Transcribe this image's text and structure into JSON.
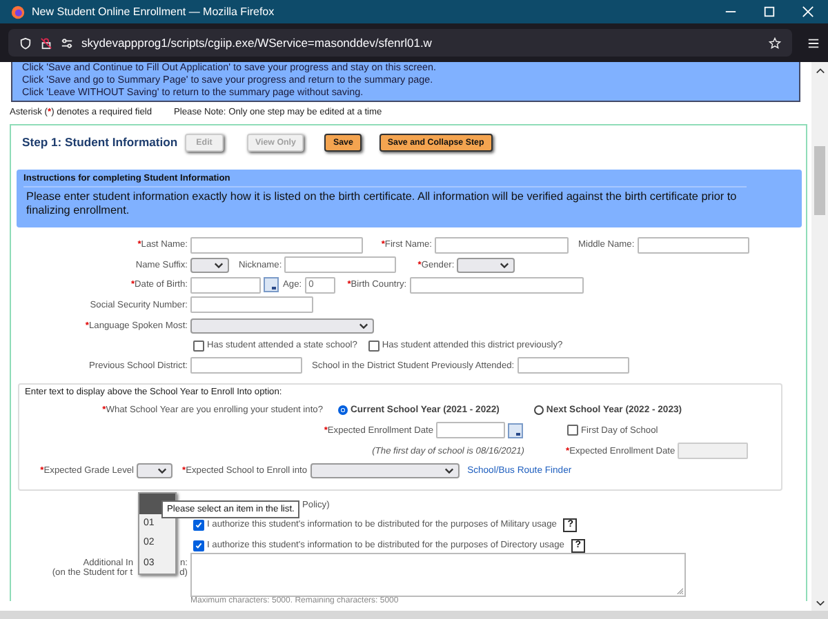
{
  "window": {
    "title": "New Student Online Enrollment — Mozilla Firefox",
    "url": "skydevappprog1/scripts/cgiip.exe/WService=masonddev/sfenrl01.w"
  },
  "notice_lines": [
    "Click 'Save and Continue to Fill Out Application' to save your progress and stay on this screen.",
    "Click 'Save and go to Summary Page' to save your progress and return to the summary page.",
    "Click 'Leave WITHOUT Saving' to return to the summary page without saving."
  ],
  "required_mark": "*",
  "legend": {
    "before": "Asterisk (",
    "after": ") denotes a required field",
    "note": "Please Note: Only one step may be edited at a time"
  },
  "step": {
    "title": "Step 1: Student Information",
    "buttons": [
      {
        "label": "Edit",
        "disabled": true
      },
      {
        "label": "View Only",
        "disabled": true
      },
      {
        "label": "Save",
        "disabled": false
      },
      {
        "label": "Save and Collapse Step",
        "disabled": false
      }
    ]
  },
  "instructions": {
    "heading": "Instructions for completing Student Information",
    "text": "Please enter student information exactly how it is listed on the birth certificate. All information will be verified against the birth certificate prior to finalizing enrollment."
  },
  "student": {
    "last_name": {
      "label": "Last Name:",
      "required": true
    },
    "first_name": {
      "label": "First Name:",
      "required": true
    },
    "middle_name": {
      "label": "Middle Name:",
      "required": false
    },
    "name_suffix": {
      "label": "Name Suffix:",
      "required": false
    },
    "nickname": {
      "label": "Nickname:",
      "required": false
    },
    "gender": {
      "label": "Gender:",
      "required": true
    },
    "date_of_birth": {
      "label": "Date of Birth:",
      "required": true
    },
    "age": {
      "label": "Age:",
      "value": "0"
    },
    "birth_country": {
      "label": "Birth Country:",
      "required": true
    },
    "ssn": {
      "label": "Social Security Number:",
      "required": false
    },
    "language": {
      "label": "Language Spoken Most:",
      "required": true
    },
    "attended_state": {
      "label": "Has student attended a state school?",
      "checked": false
    },
    "attended_district": {
      "label": "Has student attended this district previously?",
      "checked": false
    },
    "previous_district": {
      "label": "Previous School District:"
    },
    "previous_school": {
      "label": "School in the District Student Previously Attended:"
    }
  },
  "enroll": {
    "heading": "Enter text to display above the School Year to Enroll Into option:",
    "question": {
      "label": "What School Year are you enrolling your student into?",
      "required": true
    },
    "options": [
      {
        "label": "Current School Year (2021 - 2022)",
        "selected": true
      },
      {
        "label": "Next School Year (2022 - 2023)",
        "selected": false
      }
    ],
    "expected_date": {
      "label": "Expected Enrollment Date",
      "required": true
    },
    "first_day": {
      "label": "First Day of School",
      "checked": false
    },
    "next_expected_date": {
      "label": "Expected Enrollment Date",
      "required": true,
      "disabled": true
    },
    "note": "(The first day of school is 08/16/2021)",
    "grade": {
      "label": "Expected Grade Level",
      "required": true
    },
    "school": {
      "label": "Expected School to Enroll into",
      "required": true
    },
    "link": "School/Bus Route Finder"
  },
  "grade_dropdown": {
    "blank_selected": true,
    "options": [
      {
        "label": "01",
        "selected": false
      },
      {
        "label": "02",
        "selected": false
      },
      {
        "label": "03",
        "selected": false
      }
    ]
  },
  "tooltip": "Please select an item in the list.",
  "policy_fragment": "Policy)",
  "consents": [
    {
      "label": "I authorize this student's information to be distributed for the purposes of Military usage",
      "checked": true,
      "help": "?"
    },
    {
      "label": "I authorize this student's information to be distributed for the purposes of Directory usage",
      "checked": true,
      "help": "?"
    }
  ],
  "additional": {
    "line1_left": "Additional In",
    "line1_right": "n:",
    "line2_left": "(on the Student for t",
    "line2_right": "d)"
  },
  "char_hint": "Maximum characters: 5000. Remaining characters: 5000"
}
